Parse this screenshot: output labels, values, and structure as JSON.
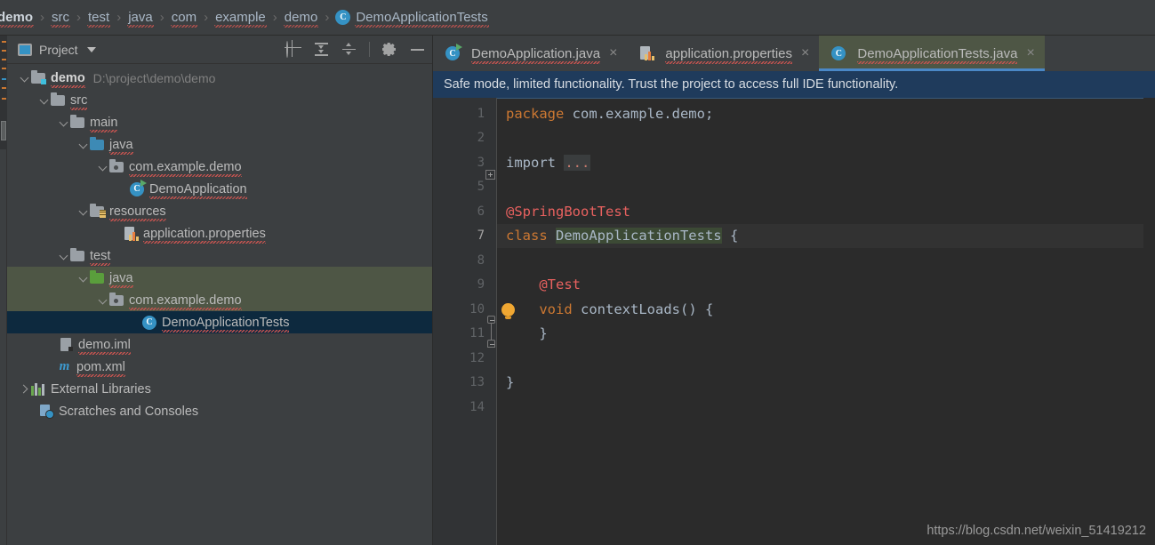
{
  "breadcrumb": {
    "items": [
      {
        "label": "demo",
        "bold": true,
        "icon": "none"
      },
      {
        "label": "src",
        "bold": false,
        "icon": "none"
      },
      {
        "label": "test",
        "bold": false,
        "icon": "none"
      },
      {
        "label": "java",
        "bold": false,
        "icon": "none"
      },
      {
        "label": "com",
        "bold": false,
        "icon": "none"
      },
      {
        "label": "example",
        "bold": false,
        "icon": "none"
      },
      {
        "label": "demo",
        "bold": false,
        "icon": "none"
      },
      {
        "label": "DemoApplicationTests",
        "bold": false,
        "icon": "class-badge"
      }
    ],
    "separator": "›",
    "class_badge_letter": "C"
  },
  "project_panel": {
    "title": "Project",
    "icons": {
      "project": "project-window-icon",
      "dropdown": "chevron-down-icon",
      "locate": "locate-in-tree-icon",
      "expand_all": "expand-all-icon",
      "collapse_all": "collapse-all-icon",
      "settings": "gear-icon",
      "minimize": "minimize-icon"
    },
    "tree": [
      {
        "label": "demo",
        "sub": "D:\\project\\demo\\demo",
        "depth": 0,
        "arrow": "down",
        "icon": "module-folder",
        "bold": true,
        "state": "none"
      },
      {
        "label": "src",
        "sub": "",
        "depth": 1,
        "arrow": "down",
        "icon": "folder-grey",
        "bold": false,
        "state": "none"
      },
      {
        "label": "main",
        "sub": "",
        "depth": 2,
        "arrow": "down",
        "icon": "folder-grey",
        "bold": false,
        "state": "none"
      },
      {
        "label": "java",
        "sub": "",
        "depth": 3,
        "arrow": "down",
        "icon": "folder-blue",
        "bold": false,
        "state": "none"
      },
      {
        "label": "com.example.demo",
        "sub": "",
        "depth": 4,
        "arrow": "down",
        "icon": "package",
        "bold": false,
        "state": "none"
      },
      {
        "label": "DemoApplication",
        "sub": "",
        "depth": 5,
        "arrow": "none",
        "icon": "class-runnable",
        "bold": false,
        "state": "none"
      },
      {
        "label": "resources",
        "sub": "",
        "depth": 3,
        "arrow": "down",
        "icon": "folder-resources",
        "bold": false,
        "state": "none"
      },
      {
        "label": "application.properties",
        "sub": "",
        "depth": 4,
        "arrow": "none",
        "icon": "properties-file",
        "bold": false,
        "state": "none"
      },
      {
        "label": "test",
        "sub": "",
        "depth": 2,
        "arrow": "down",
        "icon": "folder-grey",
        "bold": false,
        "state": "none"
      },
      {
        "label": "java",
        "sub": "",
        "depth": 3,
        "arrow": "down",
        "icon": "folder-green",
        "bold": false,
        "state": "selected-range"
      },
      {
        "label": "com.example.demo",
        "sub": "",
        "depth": 4,
        "arrow": "down",
        "icon": "package",
        "bold": false,
        "state": "selected-range"
      },
      {
        "label": "DemoApplicationTests",
        "sub": "",
        "depth": 5,
        "arrow": "none",
        "icon": "class",
        "bold": false,
        "state": "selected-focus"
      },
      {
        "label": "demo.iml",
        "sub": "",
        "depth": 2,
        "arrow": "none",
        "icon": "iml-file",
        "bold": false,
        "state": "none"
      },
      {
        "label": "pom.xml",
        "sub": "",
        "depth": 2,
        "arrow": "none",
        "icon": "maven-file",
        "bold": false,
        "state": "none"
      },
      {
        "label": "External Libraries",
        "sub": "",
        "depth": 0,
        "arrow": "right",
        "icon": "libraries",
        "bold": false,
        "state": "none"
      },
      {
        "label": "Scratches and Consoles",
        "sub": "",
        "depth": 1,
        "arrow": "none",
        "icon": "scratches",
        "bold": false,
        "state": "none"
      }
    ]
  },
  "editor": {
    "tabs": [
      {
        "label": "DemoApplication.java",
        "icon": "class-runnable-icon",
        "active": false,
        "close": "×"
      },
      {
        "label": "application.properties",
        "icon": "properties-file-icon",
        "active": false,
        "close": "×"
      },
      {
        "label": "DemoApplicationTests.java",
        "icon": "class-icon",
        "active": true,
        "close": "×"
      }
    ],
    "banner": "Safe mode, limited functionality. Trust the project to access full IDE functionality.",
    "current_line": 7,
    "code": [
      {
        "num": "1",
        "fold": "none",
        "tokens": [
          {
            "t": "package ",
            "c": "kw"
          },
          {
            "t": "com.example.demo;",
            "c": "pl"
          }
        ]
      },
      {
        "num": "2",
        "fold": "none",
        "tokens": []
      },
      {
        "num": "3",
        "fold": "plus",
        "tokens": [
          {
            "t": "import ",
            "c": "pl"
          },
          {
            "t": "...",
            "c": "dots"
          }
        ]
      },
      {
        "num": "5",
        "fold": "none",
        "tokens": []
      },
      {
        "num": "6",
        "fold": "none",
        "tokens": [
          {
            "t": "@SpringBootTest",
            "c": "annred"
          }
        ]
      },
      {
        "num": "7",
        "fold": "none",
        "tokens": [
          {
            "t": "class ",
            "c": "kw"
          },
          {
            "t": "DemoApplicationTests",
            "c": "idhl"
          },
          {
            "t": " {",
            "c": "pl"
          }
        ]
      },
      {
        "num": "8",
        "fold": "none",
        "tokens": []
      },
      {
        "num": "9",
        "fold": "none",
        "tokens": [
          {
            "t": "    @Test",
            "c": "annred"
          }
        ]
      },
      {
        "num": "10",
        "fold": "top",
        "tokens": [
          {
            "t": "    void ",
            "c": "kw"
          },
          {
            "t": "contextLoads",
            "c": "fnm"
          },
          {
            "t": "() {",
            "c": "pl"
          }
        ]
      },
      {
        "num": "11",
        "fold": "end",
        "tokens": [
          {
            "t": "    }",
            "c": "pl"
          }
        ]
      },
      {
        "num": "12",
        "fold": "none",
        "tokens": []
      },
      {
        "num": "13",
        "fold": "none",
        "tokens": [
          {
            "t": "}",
            "c": "pl"
          }
        ]
      },
      {
        "num": "14",
        "fold": "none",
        "tokens": []
      }
    ]
  },
  "watermark": "https://blog.csdn.net/weixin_51419212",
  "colors": {
    "panel_bg": "#3c3f41",
    "editor_bg": "#2b2b2b",
    "banner_bg": "#1f3b5c",
    "accent_blue": "#4a88c7",
    "selected_range": "#4e5645",
    "selected_focus": "#0d293e",
    "keyword": "#cc7832",
    "annotation": "#e8615f",
    "text": "#a9b7c6"
  }
}
